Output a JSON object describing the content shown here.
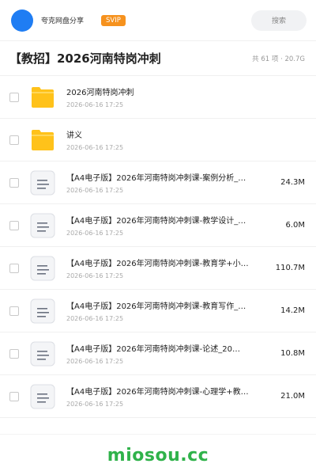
{
  "header": {
    "app_name": "夸克网盘分享",
    "svip_badge": "SVIP",
    "search_label": "搜索"
  },
  "folder": {
    "title": "【教招】2026河南特岗冲刺",
    "meta": "共 61 项 · 20.7G"
  },
  "items": [
    {
      "name": "2026河南特岗冲刺",
      "time": "2026-06-16 17:25",
      "size": "",
      "icon": "folder-icon"
    },
    {
      "name": "讲义",
      "time": "2026-06-16 17:25",
      "size": "",
      "icon": "folder-icon"
    },
    {
      "name": "【A4电子版】2026年河南特岗冲刺课-案例分析_…",
      "time": "2026-06-16 17:25",
      "size": "24.3M",
      "icon": "document-icon"
    },
    {
      "name": "【A4电子版】2026年河南特岗冲刺课-教学设计_…",
      "time": "2026-06-16 17:25",
      "size": "6.0M",
      "icon": "document-icon"
    },
    {
      "name": "【A4电子版】2026年河南特岗冲刺课-教育学+小…",
      "time": "2026-06-16 17:25",
      "size": "110.7M",
      "icon": "document-icon"
    },
    {
      "name": "【A4电子版】2026年河南特岗冲刺课-教育写作_…",
      "time": "2026-06-16 17:25",
      "size": "14.2M",
      "icon": "document-icon"
    },
    {
      "name": "【A4电子版】2026年河南特岗冲刺课-论述_20…",
      "time": "2026-06-16 17:25",
      "size": "10.8M",
      "icon": "document-icon"
    },
    {
      "name": "【A4电子版】2026年河南特岗冲刺课-心理学+教…",
      "time": "2026-06-16 17:25",
      "size": "21.0M",
      "icon": "document-icon"
    }
  ],
  "watermark": "miosou.cc",
  "colors": {
    "avatar": "#1f7df3",
    "svip": "#f6921e",
    "folder": "#ffc21a",
    "watermark": "#2fb24a"
  }
}
